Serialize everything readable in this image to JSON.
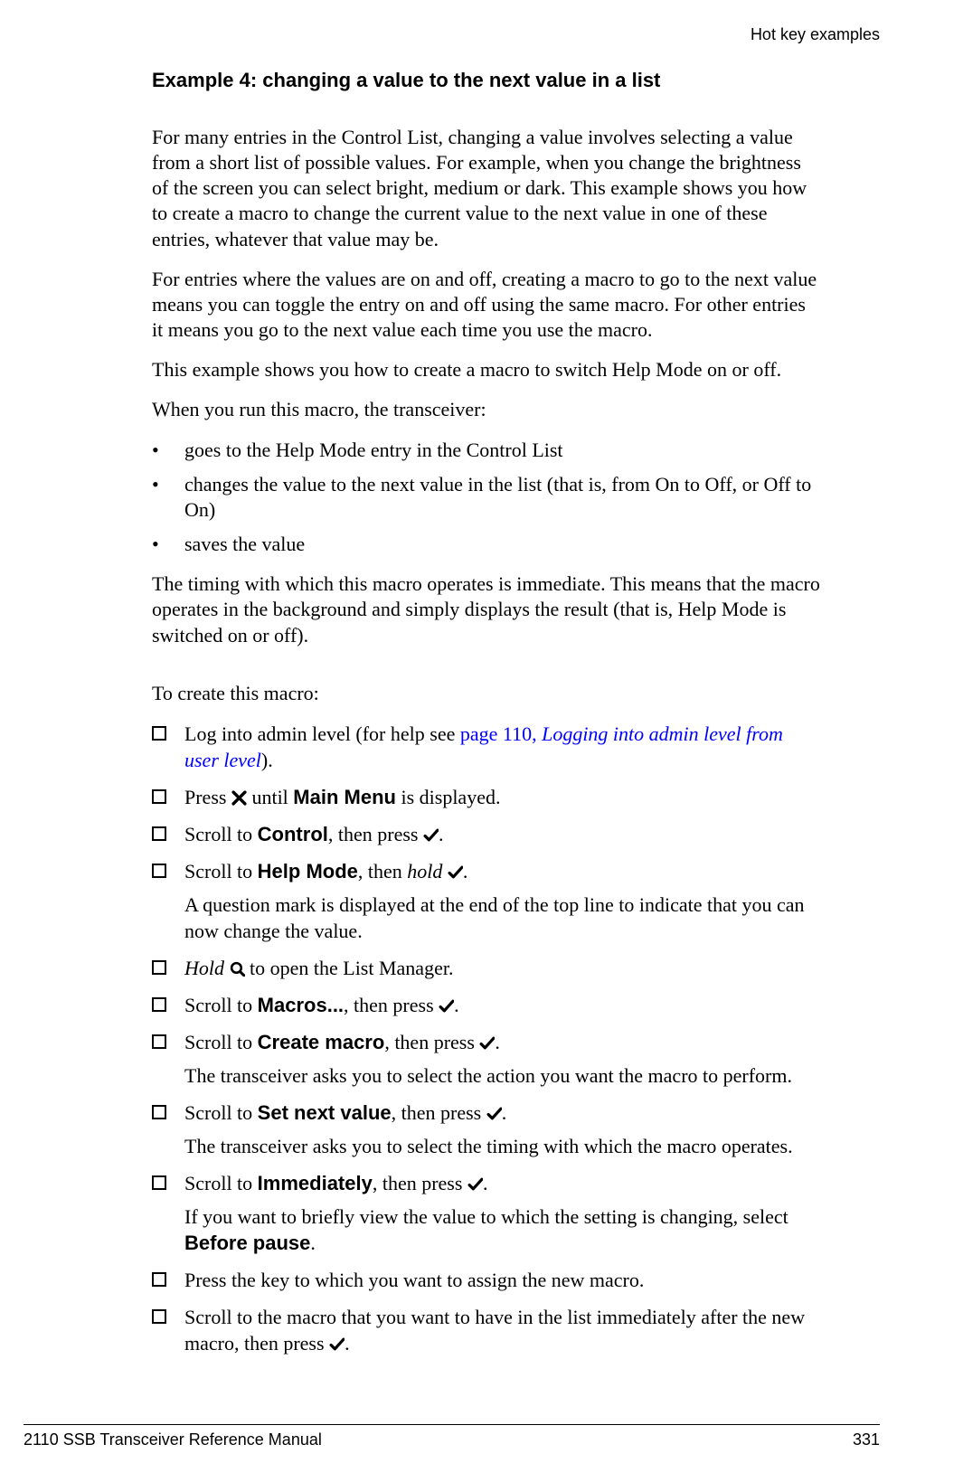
{
  "header": {
    "right": "Hot key examples"
  },
  "title": "Example 4: changing a value to the next value in a list",
  "para1": "For many entries in the Control List, changing a value involves selecting a value from a short list of possible values. For example, when you change the brightness of the screen you can select bright, medium or dark. This example shows you how to create a macro to change the current value to the next value in one of these entries, whatever that value may be.",
  "para2": "For entries where the values are on and off, creating a macro to go to the next value means you can toggle the entry on and off using the same macro. For other entries it means you go to the next value each time you use the macro.",
  "para3": "This example shows you how to create a macro to switch Help Mode on or off.",
  "para4": "When you run this macro, the transceiver:",
  "bullets": [
    "goes to the Help Mode entry in the Control List",
    "changes the value to the next value in the list (that is, from On to Off, or Off to On)",
    "saves the value"
  ],
  "para5": "The timing with which this macro operates is immediate. This means that the macro operates in the background and simply displays the result (that is, Help Mode is switched on or off).",
  "para6": "To create this macro:",
  "steps": {
    "s1": {
      "pre": "Log into admin level (for help see ",
      "link_plain": "page 110, ",
      "link_italic": "Logging into admin level from user level",
      "post": ")."
    },
    "s2": {
      "pre": "Press ",
      "mid": " until ",
      "bold": "Main Menu",
      "post": " is displayed."
    },
    "s3": {
      "pre": "Scroll to ",
      "bold": "Control",
      "mid": ", then press ",
      "post": "."
    },
    "s4": {
      "pre": "Scroll to ",
      "bold": "Help Mode",
      "mid": ", then ",
      "italic": "hold",
      "post": ".",
      "follow": "A question mark is displayed at the end of the top line to indicate that you can now change the value."
    },
    "s5": {
      "italic": "Hold",
      "post": " to open the List Manager."
    },
    "s6": {
      "pre": "Scroll to ",
      "bold": "Macros...",
      "mid": ", then press ",
      "post": "."
    },
    "s7": {
      "pre": "Scroll to ",
      "bold": "Create macro",
      "mid": ", then press ",
      "post": ".",
      "follow": "The transceiver asks you to select the action you want the macro to perform."
    },
    "s8": {
      "pre": "Scroll to ",
      "bold": "Set next value",
      "mid": ", then press ",
      "post": ".",
      "follow": "The transceiver asks you to select the timing with which the macro operates."
    },
    "s9": {
      "pre": "Scroll to ",
      "bold": "Immediately",
      "mid": ", then press ",
      "post": ".",
      "follow_pre": "If you want to briefly view the value to which the setting is changing, select ",
      "follow_bold": "Before pause",
      "follow_post": "."
    },
    "s10": {
      "text": "Press the key to which you want to assign the new macro."
    },
    "s11": {
      "pre": "Scroll to the macro that you want to have in the list immediately after the new macro, then press ",
      "post": "."
    }
  },
  "footer": {
    "left": "2110 SSB Transceiver Reference Manual",
    "right": "331"
  }
}
